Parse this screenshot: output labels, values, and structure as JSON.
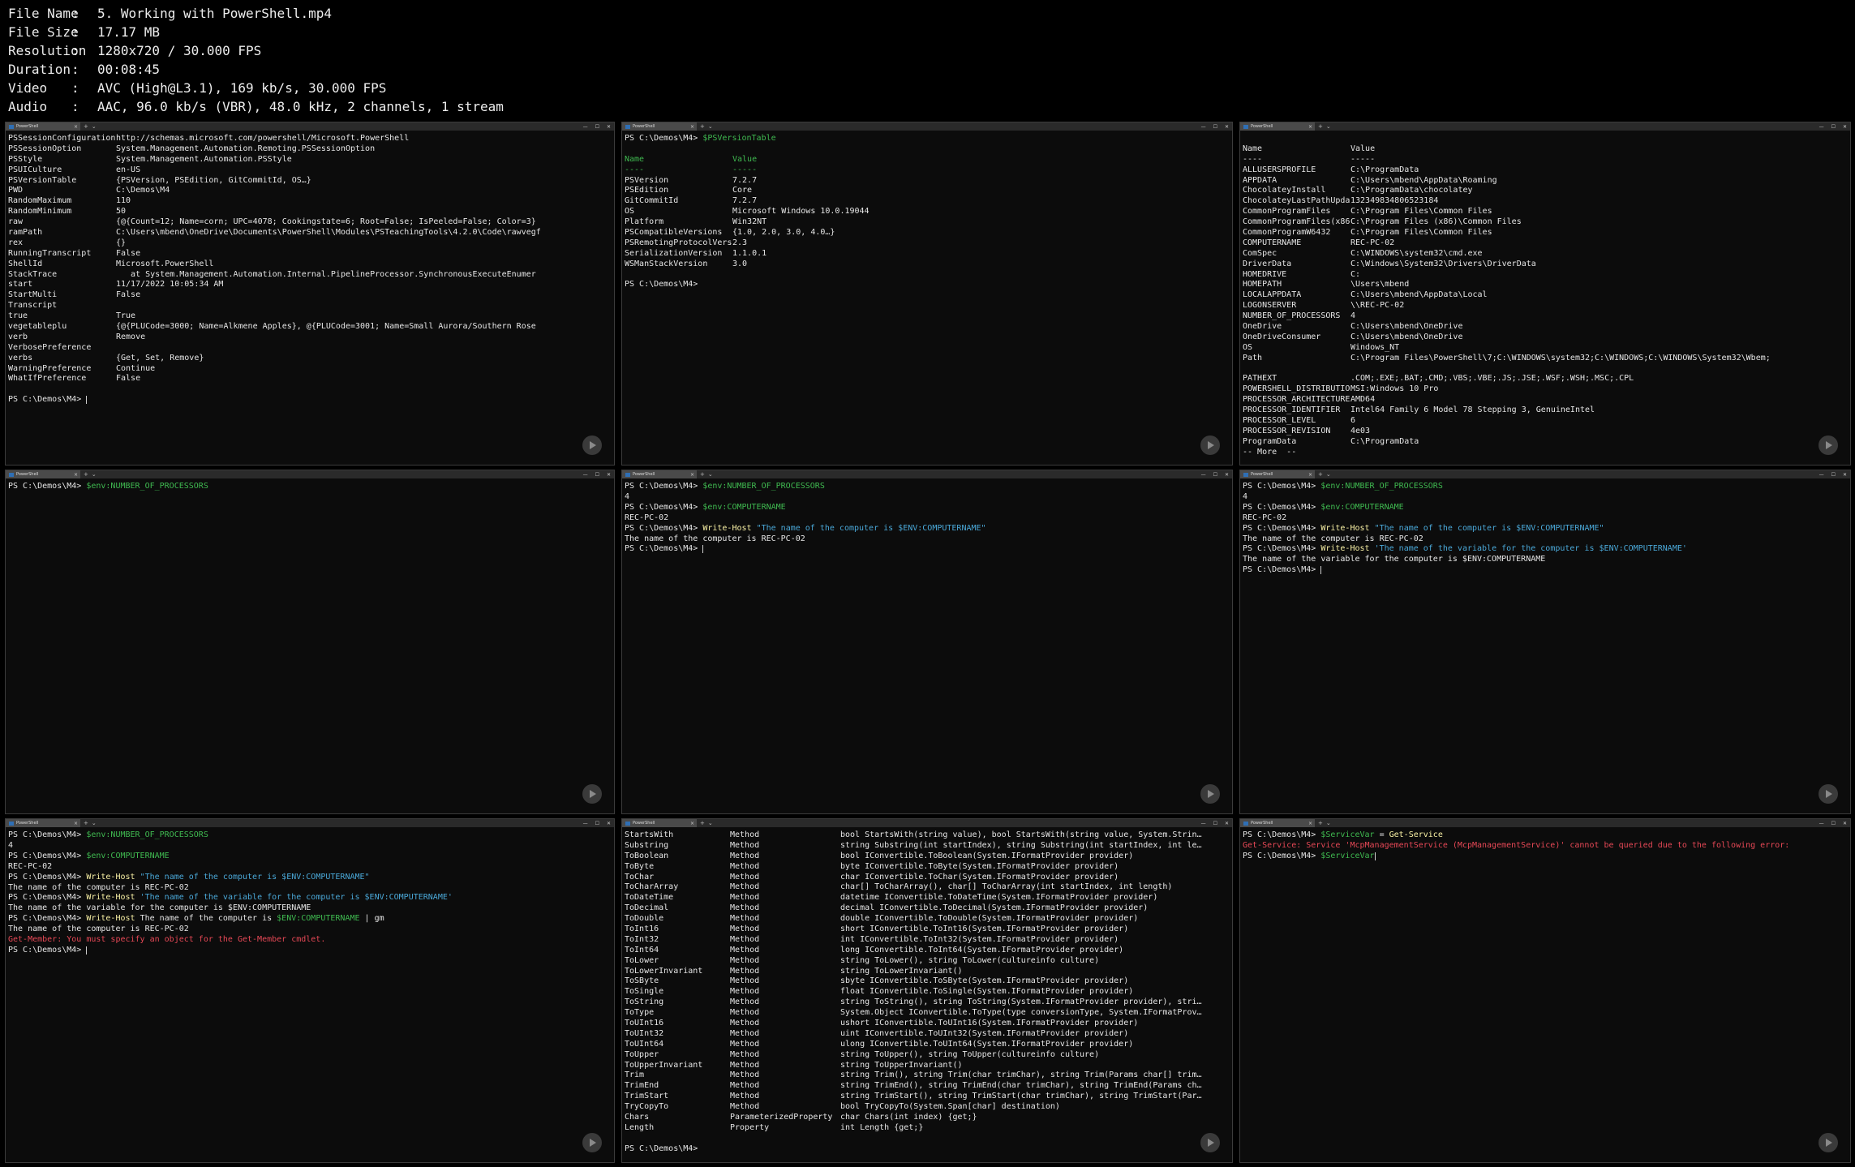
{
  "file_info": [
    {
      "key": "File Name",
      "value": "5. Working with PowerShell.mp4"
    },
    {
      "key": "File Size",
      "value": "17.17 MB"
    },
    {
      "key": "Resolution",
      "value": "1280x720 / 30.000 FPS"
    },
    {
      "key": "Duration",
      "value": "00:08:45"
    },
    {
      "key": "Video",
      "value": "AVC (High@L3.1), 169 kb/s, 30.000 FPS"
    },
    {
      "key": "Audio",
      "value": "AAC, 96.0 kb/s (VBR), 48.0 kHz, 2 channels, 1 stream"
    }
  ],
  "separator": ":",
  "window": {
    "tab_label": "PowerShell",
    "tab_close": "×",
    "new_tab": "+",
    "dropdown": "⌄",
    "minimize": "—",
    "maximize": "☐",
    "close": "✕"
  },
  "terminals": [
    {
      "col1_width": 133,
      "lines": [
        {
          "c1": "PSSessionConfigurationName",
          "c2": "http://schemas.microsoft.com/powershell/Microsoft.PowerShell"
        },
        {
          "c1": "PSSessionOption",
          "c2": "System.Management.Automation.Remoting.PSSessionOption"
        },
        {
          "c1": "PSStyle",
          "c2": "System.Management.Automation.PSStyle"
        },
        {
          "c1": "PSUICulture",
          "c2": "en-US"
        },
        {
          "c1": "PSVersionTable",
          "c2": "{PSVersion, PSEdition, GitCommitId, OS…}"
        },
        {
          "c1": "PWD",
          "c2": "C:\\Demos\\M4"
        },
        {
          "c1": "RandomMaximum",
          "c2": "110"
        },
        {
          "c1": "RandomMinimum",
          "c2": "50"
        },
        {
          "c1": "raw",
          "c2": "{@{Count=12; Name=corn; UPC=4078; Cookingstate=6; Root=False; IsPeeled=False; Color=3}"
        },
        {
          "c1": "ramPath",
          "c2": "C:\\Users\\mbend\\OneDrive\\Documents\\PowerShell\\Modules\\PSTeachingTools\\4.2.0\\Code\\rawvegf"
        },
        {
          "c1": "rex",
          "c2": "{}"
        },
        {
          "c1": "RunningTranscript",
          "c2": "False"
        },
        {
          "c1": "ShellId",
          "c2": "Microsoft.PowerShell"
        },
        {
          "c1": "StackTrace",
          "c2": "   at System.Management.Automation.Internal.PipelineProcessor.SynchronousExecuteEnumer"
        },
        {
          "c1": "start",
          "c2": "11/17/2022 10:05:34 AM"
        },
        {
          "c1": "StartMulti",
          "c2": "False"
        },
        {
          "c1": "Transcript",
          "c2": ""
        },
        {
          "c1": "true",
          "c2": "True"
        },
        {
          "c1": "vegetableplu",
          "c2": "{@{PLUCode=3000; Name=Alkmene Apples}, @{PLUCode=3001; Name=Small Aurora/Southern Rose"
        },
        {
          "c1": "verb",
          "c2": "Remove"
        },
        {
          "c1": "VerbosePreference",
          "c2": ""
        },
        {
          "c1": "verbs",
          "c2": "{Get, Set, Remove}"
        },
        {
          "c1": "WarningPreference",
          "c2": "Continue"
        },
        {
          "c1": "WhatIfPreference",
          "c2": "False"
        },
        {
          "c1": "",
          "c2": ""
        },
        {
          "prompt": "PS C:\\Demos\\M4> ",
          "cursor": true
        }
      ]
    },
    {
      "col1_width": 133,
      "lines": [
        {
          "prompt": "PS C:\\Demos\\M4> ",
          "tokens": [
            {
              "t": "$PSVersionTable",
              "k": "var"
            }
          ]
        },
        {
          "c1": "",
          "c2": ""
        },
        {
          "c1": "Name",
          "c2": "Value",
          "style": "hdr"
        },
        {
          "c1": "----",
          "c2": "-----",
          "style": "hdr"
        },
        {
          "c1": "PSVersion",
          "c2": "7.2.7"
        },
        {
          "c1": "PSEdition",
          "c2": "Core"
        },
        {
          "c1": "GitCommitId",
          "c2": "7.2.7"
        },
        {
          "c1": "OS",
          "c2": "Microsoft Windows 10.0.19044"
        },
        {
          "c1": "Platform",
          "c2": "Win32NT"
        },
        {
          "c1": "PSCompatibleVersions",
          "c2": "{1.0, 2.0, 3.0, 4.0…}"
        },
        {
          "c1": "PSRemotingProtocolVersion",
          "c2": "2.3"
        },
        {
          "c1": "SerializationVersion",
          "c2": "1.1.0.1"
        },
        {
          "c1": "WSManStackVersion",
          "c2": "3.0"
        },
        {
          "c1": "",
          "c2": ""
        },
        {
          "prompt": "PS C:\\Demos\\M4> "
        }
      ]
    },
    {
      "col1_width": 133,
      "lines": [
        {
          "c1": "",
          "c2": ""
        },
        {
          "c1": "Name",
          "c2": "Value"
        },
        {
          "c1": "----",
          "c2": "-----"
        },
        {
          "c1": "ALLUSERSPROFILE",
          "c2": "C:\\ProgramData"
        },
        {
          "c1": "APPDATA",
          "c2": "C:\\Users\\mbend\\AppData\\Roaming"
        },
        {
          "c1": "ChocolateyInstall",
          "c2": "C:\\ProgramData\\chocolatey"
        },
        {
          "c1": "ChocolateyLastPathUpdate",
          "c2": "132349834806523184"
        },
        {
          "c1": "CommonProgramFiles",
          "c2": "C:\\Program Files\\Common Files"
        },
        {
          "c1": "CommonProgramFiles(x86)",
          "c2": "C:\\Program Files (x86)\\Common Files"
        },
        {
          "c1": "CommonProgramW6432",
          "c2": "C:\\Program Files\\Common Files"
        },
        {
          "c1": "COMPUTERNAME",
          "c2": "REC-PC-02"
        },
        {
          "c1": "ComSpec",
          "c2": "C:\\WINDOWS\\system32\\cmd.exe"
        },
        {
          "c1": "DriverData",
          "c2": "C:\\Windows\\System32\\Drivers\\DriverData"
        },
        {
          "c1": "HOMEDRIVE",
          "c2": "C:"
        },
        {
          "c1": "HOMEPATH",
          "c2": "\\Users\\mbend"
        },
        {
          "c1": "LOCALAPPDATA",
          "c2": "C:\\Users\\mbend\\AppData\\Local"
        },
        {
          "c1": "LOGONSERVER",
          "c2": "\\\\REC-PC-02"
        },
        {
          "c1": "NUMBER_OF_PROCESSORS",
          "c2": "4"
        },
        {
          "c1": "OneDrive",
          "c2": "C:\\Users\\mbend\\OneDrive"
        },
        {
          "c1": "OneDriveConsumer",
          "c2": "C:\\Users\\mbend\\OneDrive"
        },
        {
          "c1": "OS",
          "c2": "Windows_NT"
        },
        {
          "c1": "Path",
          "c2": "C:\\Program Files\\PowerShell\\7;C:\\WINDOWS\\system32;C:\\WINDOWS;C:\\WINDOWS\\System32\\Wbem;"
        },
        {
          "c1": "",
          "c2": ""
        },
        {
          "c1": "PATHEXT",
          "c2": ".COM;.EXE;.BAT;.CMD;.VBS;.VBE;.JS;.JSE;.WSF;.WSH;.MSC;.CPL"
        },
        {
          "c1": "POWERSHELL_DISTRIBUTION_CHANNEL",
          "c2": "MSI:Windows 10 Pro"
        },
        {
          "c1": "PROCESSOR_ARCHITECTURE",
          "c2": "AMD64"
        },
        {
          "c1": "PROCESSOR_IDENTIFIER",
          "c2": "Intel64 Family 6 Model 78 Stepping 3, GenuineIntel"
        },
        {
          "c1": "PROCESSOR_LEVEL",
          "c2": "6"
        },
        {
          "c1": "PROCESSOR_REVISION",
          "c2": "4e03"
        },
        {
          "c1": "ProgramData",
          "c2": "C:\\ProgramData"
        },
        {
          "c1": "-- More  --",
          "c2": ""
        }
      ]
    },
    {
      "col1_width": 133,
      "lines": [
        {
          "prompt": "PS C:\\Demos\\M4> ",
          "tokens": [
            {
              "t": "$env:NUMBER_OF_PROCESSORS",
              "k": "var"
            }
          ]
        }
      ]
    },
    {
      "col1_width": 133,
      "lines": [
        {
          "prompt": "PS C:\\Demos\\M4> ",
          "tokens": [
            {
              "t": "$env:NUMBER_OF_PROCESSORS",
              "k": "var"
            }
          ]
        },
        {
          "text": "4"
        },
        {
          "prompt": "PS C:\\Demos\\M4> ",
          "tokens": [
            {
              "t": "$env:COMPUTERNAME",
              "k": "var"
            }
          ]
        },
        {
          "text": "REC-PC-02"
        },
        {
          "prompt": "PS C:\\Demos\\M4> ",
          "tokens": [
            {
              "t": "Write-Host",
              "k": "cmd"
            },
            {
              "t": " ",
              "k": ""
            },
            {
              "t": "\"The name of the computer is $ENV:COMPUTERNAME\"",
              "k": "str"
            }
          ]
        },
        {
          "text": "The name of the computer is REC-PC-02"
        },
        {
          "prompt": "PS C:\\Demos\\M4> ",
          "cursor": true
        }
      ]
    },
    {
      "col1_width": 133,
      "lines": [
        {
          "prompt": "PS C:\\Demos\\M4> ",
          "tokens": [
            {
              "t": "$env:NUMBER_OF_PROCESSORS",
              "k": "var"
            }
          ]
        },
        {
          "text": "4"
        },
        {
          "prompt": "PS C:\\Demos\\M4> ",
          "tokens": [
            {
              "t": "$env:COMPUTERNAME",
              "k": "var"
            }
          ]
        },
        {
          "text": "REC-PC-02"
        },
        {
          "prompt": "PS C:\\Demos\\M4> ",
          "tokens": [
            {
              "t": "Write-Host",
              "k": "cmd"
            },
            {
              "t": " ",
              "k": ""
            },
            {
              "t": "\"The name of the computer is $ENV:COMPUTERNAME\"",
              "k": "str"
            }
          ]
        },
        {
          "text": "The name of the computer is REC-PC-02"
        },
        {
          "prompt": "PS C:\\Demos\\M4> ",
          "tokens": [
            {
              "t": "Write-Host",
              "k": "cmd"
            },
            {
              "t": " ",
              "k": ""
            },
            {
              "t": "'The name of the variable for the computer is $ENV:COMPUTERNAME'",
              "k": "str"
            }
          ]
        },
        {
          "text": "The name of the variable for the computer is $ENV:COMPUTERNAME"
        },
        {
          "prompt": "PS C:\\Demos\\M4> ",
          "cursor": true
        }
      ]
    },
    {
      "col1_width": 133,
      "lines": [
        {
          "prompt": "PS C:\\Demos\\M4> ",
          "tokens": [
            {
              "t": "$env:NUMBER_OF_PROCESSORS",
              "k": "var"
            }
          ]
        },
        {
          "text": "4"
        },
        {
          "prompt": "PS C:\\Demos\\M4> ",
          "tokens": [
            {
              "t": "$env:COMPUTERNAME",
              "k": "var"
            }
          ]
        },
        {
          "text": "REC-PC-02"
        },
        {
          "prompt": "PS C:\\Demos\\M4> ",
          "tokens": [
            {
              "t": "Write-Host",
              "k": "cmd"
            },
            {
              "t": " ",
              "k": ""
            },
            {
              "t": "\"The name of the computer is $ENV:COMPUTERNAME\"",
              "k": "str"
            }
          ]
        },
        {
          "text": "The name of the computer is REC-PC-02"
        },
        {
          "prompt": "PS C:\\Demos\\M4> ",
          "tokens": [
            {
              "t": "Write-Host",
              "k": "cmd"
            },
            {
              "t": " ",
              "k": ""
            },
            {
              "t": "'The name of the variable for the computer is $ENV:COMPUTERNAME'",
              "k": "str"
            }
          ]
        },
        {
          "text": "The name of the variable for the computer is $ENV:COMPUTERNAME"
        },
        {
          "prompt": "PS C:\\Demos\\M4> ",
          "tokens": [
            {
              "t": "Write-Host",
              "k": "cmd"
            },
            {
              "t": " The name of the computer is ",
              "k": ""
            },
            {
              "t": "$ENV:COMPUTERNAME",
              "k": "var"
            },
            {
              "t": " | gm",
              "k": ""
            }
          ]
        },
        {
          "text": "The name of the computer is REC-PC-02"
        },
        {
          "text": "Get-Member: You must specify an object for the Get-Member cmdlet.",
          "style": "err"
        },
        {
          "prompt": "PS C:\\Demos\\M4> ",
          "cursor": true
        }
      ]
    },
    {
      "col1_width": 130,
      "col2_width": 136,
      "lines": [
        {
          "c1": "StartsWith",
          "c2": "Method",
          "c3": "bool StartsWith(string value), bool StartsWith(string value, System.Strin…"
        },
        {
          "c1": "Substring",
          "c2": "Method",
          "c3": "string Substring(int startIndex), string Substring(int startIndex, int le…"
        },
        {
          "c1": "ToBoolean",
          "c2": "Method",
          "c3": "bool IConvertible.ToBoolean(System.IFormatProvider provider)"
        },
        {
          "c1": "ToByte",
          "c2": "Method",
          "c3": "byte IConvertible.ToByte(System.IFormatProvider provider)"
        },
        {
          "c1": "ToChar",
          "c2": "Method",
          "c3": "char IConvertible.ToChar(System.IFormatProvider provider)"
        },
        {
          "c1": "ToCharArray",
          "c2": "Method",
          "c3": "char[] ToCharArray(), char[] ToCharArray(int startIndex, int length)"
        },
        {
          "c1": "ToDateTime",
          "c2": "Method",
          "c3": "datetime IConvertible.ToDateTime(System.IFormatProvider provider)"
        },
        {
          "c1": "ToDecimal",
          "c2": "Method",
          "c3": "decimal IConvertible.ToDecimal(System.IFormatProvider provider)"
        },
        {
          "c1": "ToDouble",
          "c2": "Method",
          "c3": "double IConvertible.ToDouble(System.IFormatProvider provider)"
        },
        {
          "c1": "ToInt16",
          "c2": "Method",
          "c3": "short IConvertible.ToInt16(System.IFormatProvider provider)"
        },
        {
          "c1": "ToInt32",
          "c2": "Method",
          "c3": "int IConvertible.ToInt32(System.IFormatProvider provider)"
        },
        {
          "c1": "ToInt64",
          "c2": "Method",
          "c3": "long IConvertible.ToInt64(System.IFormatProvider provider)"
        },
        {
          "c1": "ToLower",
          "c2": "Method",
          "c3": "string ToLower(), string ToLower(cultureinfo culture)"
        },
        {
          "c1": "ToLowerInvariant",
          "c2": "Method",
          "c3": "string ToLowerInvariant()"
        },
        {
          "c1": "ToSByte",
          "c2": "Method",
          "c3": "sbyte IConvertible.ToSByte(System.IFormatProvider provider)"
        },
        {
          "c1": "ToSingle",
          "c2": "Method",
          "c3": "float IConvertible.ToSingle(System.IFormatProvider provider)"
        },
        {
          "c1": "ToString",
          "c2": "Method",
          "c3": "string ToString(), string ToString(System.IFormatProvider provider), stri…"
        },
        {
          "c1": "ToType",
          "c2": "Method",
          "c3": "System.Object IConvertible.ToType(type conversionType, System.IFormatProv…"
        },
        {
          "c1": "ToUInt16",
          "c2": "Method",
          "c3": "ushort IConvertible.ToUInt16(System.IFormatProvider provider)"
        },
        {
          "c1": "ToUInt32",
          "c2": "Method",
          "c3": "uint IConvertible.ToUInt32(System.IFormatProvider provider)"
        },
        {
          "c1": "ToUInt64",
          "c2": "Method",
          "c3": "ulong IConvertible.ToUInt64(System.IFormatProvider provider)"
        },
        {
          "c1": "ToUpper",
          "c2": "Method",
          "c3": "string ToUpper(), string ToUpper(cultureinfo culture)"
        },
        {
          "c1": "ToUpperInvariant",
          "c2": "Method",
          "c3": "string ToUpperInvariant()"
        },
        {
          "c1": "Trim",
          "c2": "Method",
          "c3": "string Trim(), string Trim(char trimChar), string Trim(Params char[] trim…"
        },
        {
          "c1": "TrimEnd",
          "c2": "Method",
          "c3": "string TrimEnd(), string TrimEnd(char trimChar), string TrimEnd(Params ch…"
        },
        {
          "c1": "TrimStart",
          "c2": "Method",
          "c3": "string TrimStart(), string TrimStart(char trimChar), string TrimStart(Par…"
        },
        {
          "c1": "TryCopyTo",
          "c2": "Method",
          "c3": "bool TryCopyTo(System.Span[char] destination)"
        },
        {
          "c1": "Chars",
          "c2": "ParameterizedProperty",
          "c3": "char Chars(int index) {get;}"
        },
        {
          "c1": "Length",
          "c2": "Property",
          "c3": "int Length {get;}"
        },
        {
          "c1": "",
          "c2": "",
          "c3": ""
        },
        {
          "prompt": "PS C:\\Demos\\M4> "
        }
      ]
    },
    {
      "col1_width": 133,
      "lines": [
        {
          "prompt": "PS C:\\Demos\\M4> ",
          "tokens": [
            {
              "t": "$ServiceVar",
              "k": "var"
            },
            {
              "t": " = ",
              "k": ""
            },
            {
              "t": "Get-Service",
              "k": "cmd"
            }
          ]
        },
        {
          "text": "Get-Service: Service 'McpManagementService (McpManagementService)' cannot be queried due to the following error:",
          "style": "err"
        },
        {
          "prompt": "PS C:\\Demos\\M4> ",
          "tokens": [
            {
              "t": "$ServiceVar",
              "k": "var"
            }
          ],
          "cursor": true
        }
      ]
    }
  ]
}
